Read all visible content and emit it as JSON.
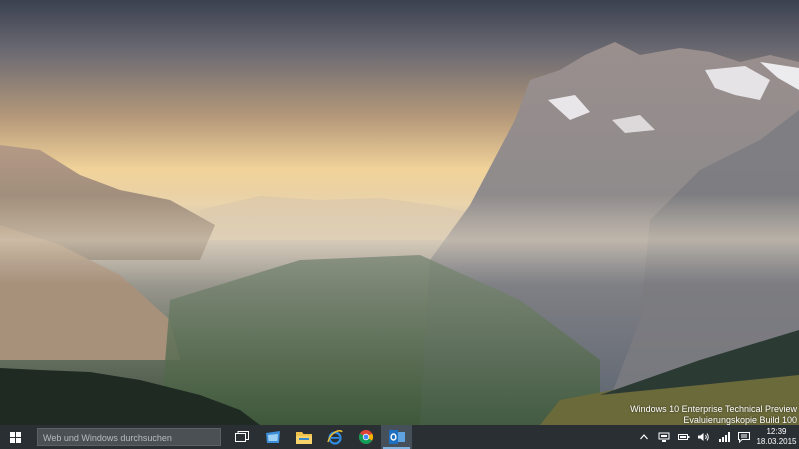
{
  "watermark": {
    "line1": "Windows 10 Enterprise Technical Preview",
    "line2": "Evaluierungskopie Build 100"
  },
  "taskbar": {
    "search_placeholder": "Web und Windows durchsuchen",
    "pinned": [
      {
        "icon": "task-view-icon"
      },
      {
        "icon": "store-icon"
      },
      {
        "icon": "file-explorer-icon"
      },
      {
        "icon": "internet-explorer-icon"
      },
      {
        "icon": "chrome-icon"
      },
      {
        "icon": "outlook-icon",
        "active": true
      }
    ],
    "tray_icons": [
      "chevron-up-icon",
      "network-adapter-icon",
      "battery-icon",
      "speaker-icon",
      "signal-icon",
      "action-center-icon"
    ],
    "clock": {
      "time": "12:39",
      "date": "18.03.2015"
    }
  },
  "colors": {
    "taskbar": "#2a2f33",
    "accent": "#7fb2e0"
  }
}
